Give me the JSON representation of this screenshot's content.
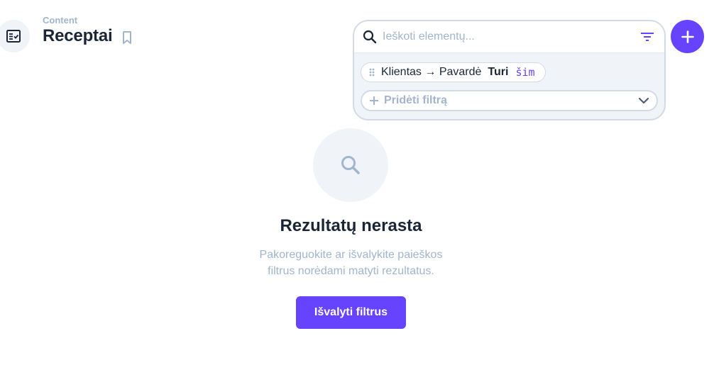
{
  "header": {
    "breadcrumb": "Content",
    "title": "Receptai"
  },
  "search": {
    "placeholder": "Ieškoti elementų..."
  },
  "filters": [
    {
      "field": "Klientas → Pavardė",
      "operator": "Turi",
      "value": "šim"
    }
  ],
  "add_filter_label": "Pridėti filtrą",
  "empty_state": {
    "title": "Rezultatų nerasta",
    "description_line1": "Pakoreguokite ar išvalykite paieškos",
    "description_line2": "filtrus norėdami matyti rezultatus.",
    "button_label": "Išvalyti filtrus"
  },
  "icons": {
    "collection": "collection-list-icon",
    "bookmark": "bookmark-icon",
    "search": "search-icon",
    "filter": "filter-icon",
    "drag": "drag-handle-icon",
    "add_filter": "plus-icon",
    "expand": "chevron-down-icon",
    "create": "plus-icon",
    "empty_search": "search-icon"
  },
  "colors": {
    "accent": "#6644ff",
    "muted": "#a2b5cd",
    "text": "#1a2536",
    "background_subdued": "#f0f4f9",
    "border": "#d3dae4"
  }
}
